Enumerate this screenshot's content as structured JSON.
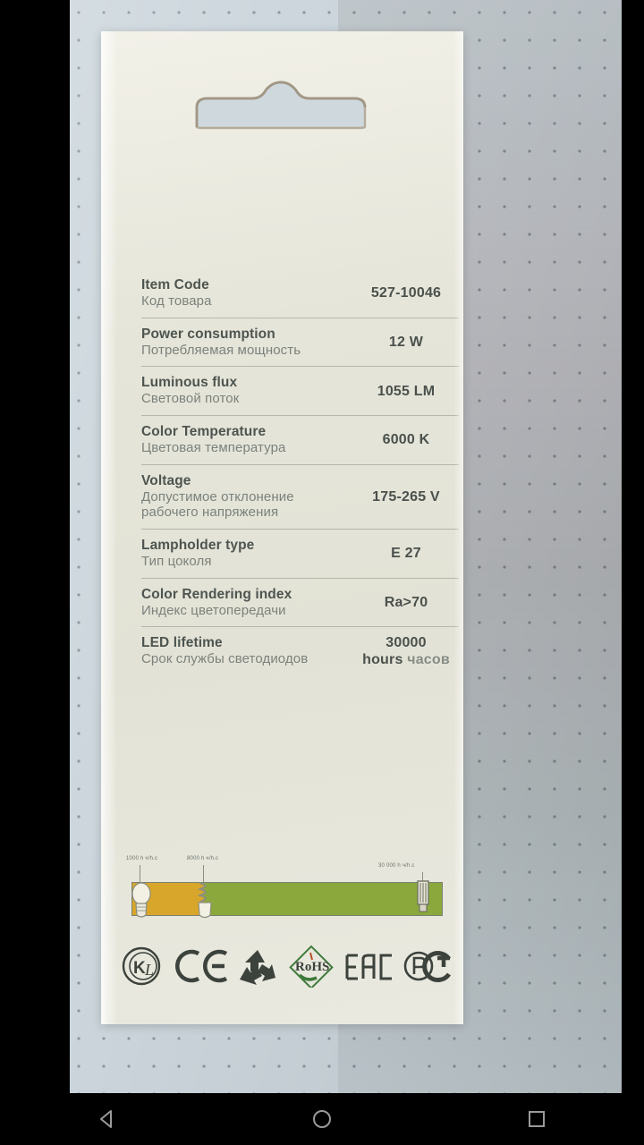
{
  "app": {
    "type": "photo-viewer",
    "subject": "LED lamp blister package back label"
  },
  "package": {
    "hangtab_name": "euro-slot-hang-tab",
    "spec_rows": [
      {
        "en": "Item Code",
        "ru": "Код товара",
        "value": "527-10046"
      },
      {
        "en": "Power consumption",
        "ru": "Потребляемая мощность",
        "value": "12 W"
      },
      {
        "en": "Luminous flux",
        "ru": "Световой поток",
        "value": "1055 LM"
      },
      {
        "en": "Color Temperature",
        "ru": "Цветовая температура",
        "value": "6000 K"
      },
      {
        "en": "Voltage",
        "ru": "Допустимое отклонение рабочего напряжения",
        "value": "175-265 V"
      },
      {
        "en": "Lampholder type",
        "ru": "Тип цоколя",
        "value": "E 27"
      },
      {
        "en": "Color Rendering index",
        "ru": "Индекс цветопередачи",
        "value": "Ra>70"
      },
      {
        "en": "LED lifetime",
        "ru": "Срок службы светодиодов",
        "value": "30000",
        "value_unit_en": "hours",
        "value_unit_ru": "часов"
      }
    ],
    "lifetime_bar": {
      "ticks": [
        {
          "label": "1000 h ч/h.c",
          "position_pct": 0
        },
        {
          "label": "8000 h ч/h.c",
          "position_pct": 23
        },
        {
          "label": "30 000 h ч/h.c",
          "position_pct": 94
        }
      ],
      "segments": [
        {
          "name": "incandescent",
          "color": "#d8a62b",
          "width_pct": 23
        },
        {
          "name": "led",
          "color": "#8ba83c",
          "width_pct": 77
        }
      ]
    },
    "certifications": [
      {
        "name": "kc-mark",
        "label": "KC"
      },
      {
        "name": "ce-mark",
        "label": "CE"
      },
      {
        "name": "recycling-mark",
        "label": ""
      },
      {
        "name": "rohs-mark",
        "label": "RoHS"
      },
      {
        "name": "eac-mark",
        "label": "EAC"
      },
      {
        "name": "pct-mark",
        "label": "PCT"
      }
    ]
  },
  "colors": {
    "card": "#e7e6da",
    "label_en": "#4e5550",
    "label_ru": "#7b827c",
    "value": "#4a514c",
    "bar_orange": "#d8a62b",
    "bar_green": "#8ba83c",
    "pegboard": "#ccd6dc"
  },
  "navbar": {
    "back": "back-button",
    "home": "home-button",
    "recents": "recents-button"
  }
}
